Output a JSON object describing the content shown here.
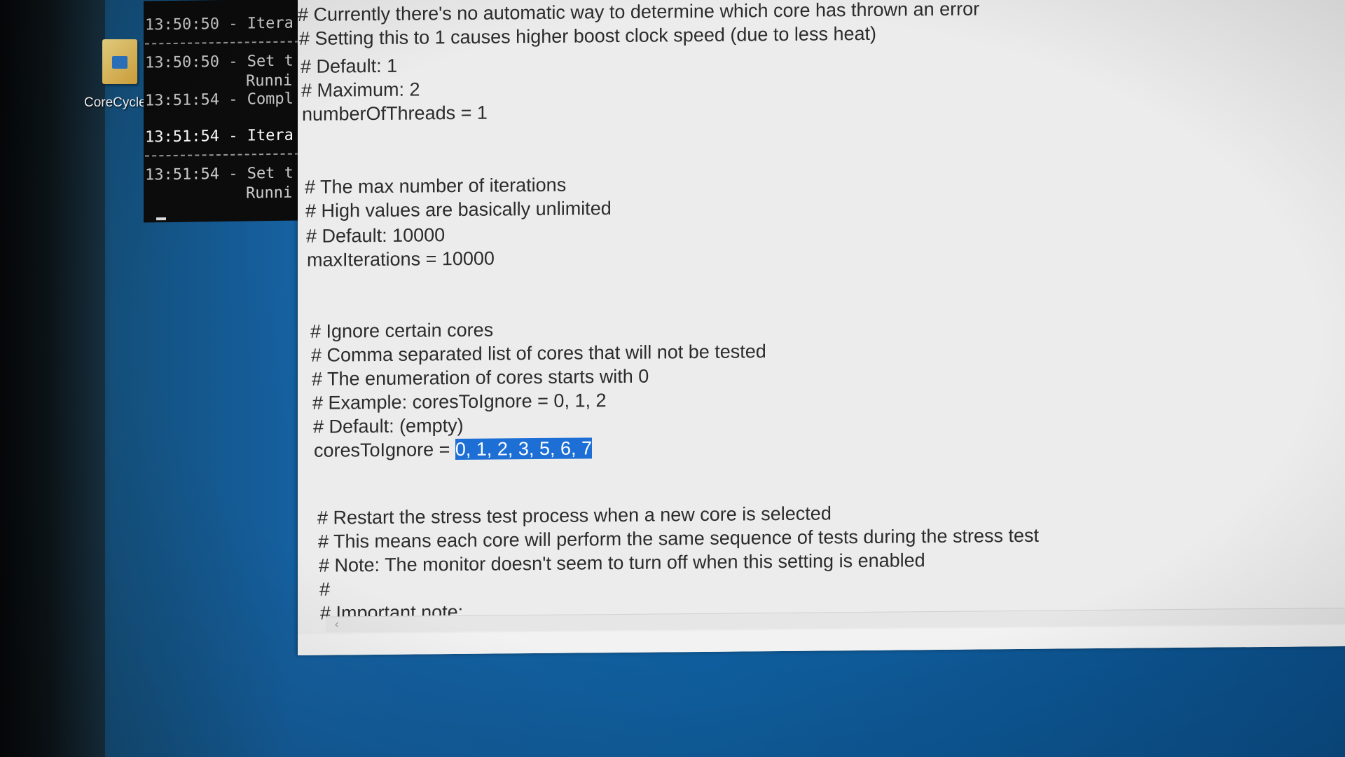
{
  "desktop": {
    "icon_label": "CoreCycle"
  },
  "console": {
    "lines": [
      "13:50:50 - Itera",
      "13:50:50 - Set t",
      "Runni",
      "13:51:54 - Compl",
      "13:51:54 - Itera",
      "13:51:54 - Set t",
      "Runni"
    ]
  },
  "editor": {
    "lines": [
      "# Currently there's no automatic way to determine which core has thrown an error",
      "# Setting this to 1 causes higher boost clock speed (due to less heat)",
      "# Default: 1",
      "# Maximum: 2",
      "numberOfThreads = 1",
      "# The max number of iterations",
      "# High values are basically unlimited",
      "# Default: 10000",
      "maxIterations = 10000",
      "# Ignore certain cores",
      "# Comma separated list of cores that will not be tested",
      "# The enumeration of cores starts with 0",
      "# Example: coresToIgnore = 0, 1, 2",
      "# Default: (empty)",
      "coresToIgnore = ",
      "# Restart the stress test process when a new core is selected",
      "# This means each core will perform the same sequence of tests during the stress test",
      "# Note: The monitor doesn't seem to turn off when this setting is enabled",
      "#",
      "# Important note:"
    ],
    "selected_text": "0, 1, 2, 3, 5, 6, 7"
  },
  "colors": {
    "selection": "#1d6fd6",
    "desktop": "#1560a0",
    "console_bg": "#0c0c0c"
  }
}
